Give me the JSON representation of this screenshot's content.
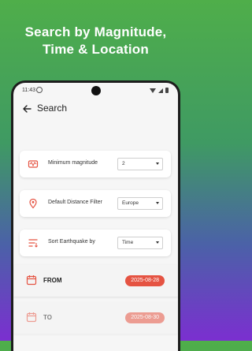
{
  "promo": {
    "line1": "Search by Magnitude,",
    "line2": "Time & Location"
  },
  "status_bar": {
    "time": "11:43"
  },
  "app_bar": {
    "title": "Search"
  },
  "filters": [
    {
      "label": "Minimum magnitude",
      "value": "2",
      "icon": "magnitude-icon"
    },
    {
      "label": "Default Distance Filter",
      "value": "Europe",
      "icon": "location-icon"
    },
    {
      "label": "Sort Earthquake by",
      "value": "Time",
      "icon": "sort-icon"
    }
  ],
  "date_range": {
    "from_label": "FROM",
    "from_value": "2025-08-28",
    "to_label": "TO",
    "to_value": "2025-08-30"
  },
  "colors": {
    "accent": "#e55342",
    "gradient_top": "#4fae4a",
    "gradient_bottom": "#7b2fd0"
  }
}
